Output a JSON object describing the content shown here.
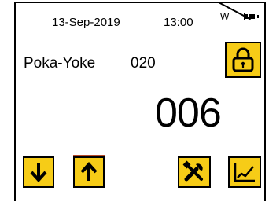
{
  "status_bar": {
    "date": "13-Sep-2019",
    "time": "13:00",
    "signal": "W",
    "battery_icon": "battery-full-icon"
  },
  "main": {
    "label": "Poka-Yoke",
    "code": "020",
    "count": "006"
  },
  "buttons": {
    "lock": "lock-icon",
    "down": "arrow-down-icon",
    "up": "arrow-up-icon",
    "tools": "tools-icon",
    "chart": "chart-icon"
  },
  "colors": {
    "button_bg": "#f6cc17",
    "border": "#000000"
  }
}
